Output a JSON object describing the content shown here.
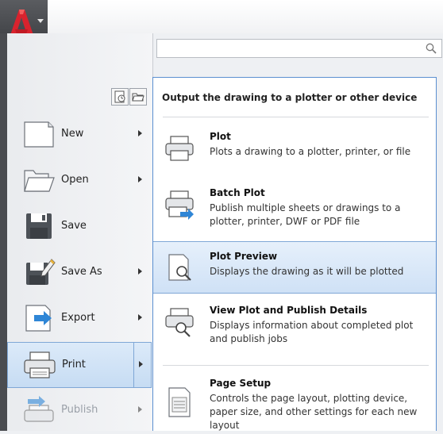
{
  "search": {
    "placeholder": ""
  },
  "menu": {
    "items": [
      {
        "label": "New",
        "icon": "new-document-icon"
      },
      {
        "label": "Open",
        "icon": "folder-open-icon"
      },
      {
        "label": "Save",
        "icon": "floppy-disk-icon"
      },
      {
        "label": "Save As",
        "icon": "save-as-icon"
      },
      {
        "label": "Export",
        "icon": "export-icon"
      },
      {
        "label": "Print",
        "icon": "printer-icon"
      },
      {
        "label": "Publish",
        "icon": "publish-icon"
      }
    ]
  },
  "submenu": {
    "header": "Output the drawing to a plotter or other device",
    "items": [
      {
        "title": "Plot",
        "desc": "Plots a drawing to a plotter, printer, or file"
      },
      {
        "title": "Batch Plot",
        "desc": "Publish multiple sheets or drawings to a plotter, printer, DWF or PDF file"
      },
      {
        "title": "Plot Preview",
        "desc": "Displays the drawing as it will be plotted"
      },
      {
        "title": "View Plot and Publish Details",
        "desc": "Displays information about completed plot and publish jobs"
      },
      {
        "title": "Page Setup",
        "desc": "Controls the page layout, plotting device, paper size, and other settings for each new layout"
      }
    ]
  },
  "colors": {
    "accent": "#5b8fd0",
    "app_red": "#d9232e"
  }
}
